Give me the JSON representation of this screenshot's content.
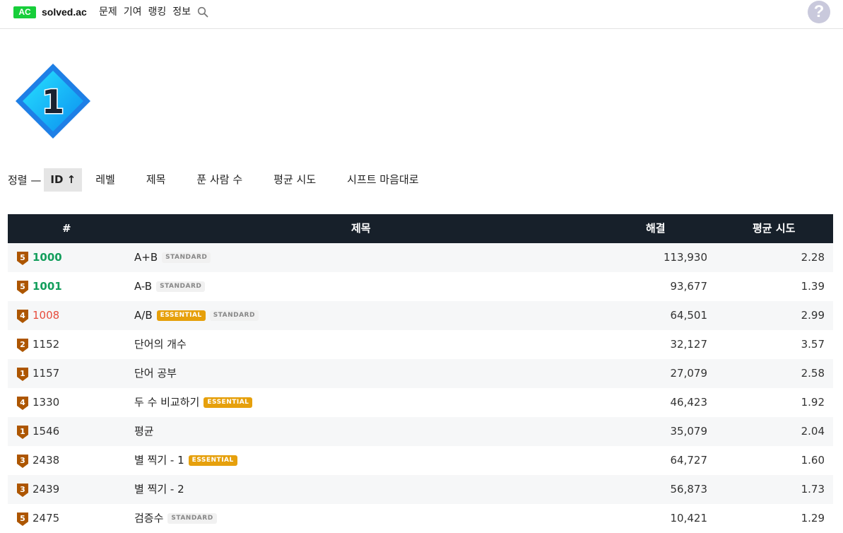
{
  "header": {
    "logo_badge": "AC",
    "logo_text": "solved.ac",
    "nav": [
      "문제",
      "기여",
      "랭킹",
      "정보"
    ],
    "search_icon": "search-icon",
    "help_icon_text": "?"
  },
  "colors": {
    "accent_green": "#17ce3a",
    "header_bg": "#17202a",
    "solved": "#139e5c",
    "wrong": "#e74c3c",
    "essential_tag": "#e6a00c",
    "bronze": "#ad5600"
  },
  "tier_badge": {
    "label": "1",
    "icon": "diamond-tier-badge"
  },
  "sort": {
    "label": "정렬 —",
    "options": [
      "ID ↑",
      "레벨",
      "제목",
      "푼 사람 수",
      "평균 시도",
      "시프트 마음대로"
    ]
  },
  "table": {
    "headers": {
      "id": "#",
      "title": "제목",
      "solved": "해결",
      "avg": "평균 시도"
    },
    "rows": [
      {
        "tier": "5",
        "id": "1000",
        "status": "solved",
        "title": "A+B",
        "tags": [
          "STANDARD"
        ],
        "solved": "113,930",
        "avg": "2.28"
      },
      {
        "tier": "5",
        "id": "1001",
        "status": "solved",
        "title": "A-B",
        "tags": [
          "STANDARD"
        ],
        "solved": "93,677",
        "avg": "1.39"
      },
      {
        "tier": "4",
        "id": "1008",
        "status": "wrong",
        "title": "A/B",
        "tags": [
          "ESSENTIAL",
          "STANDARD"
        ],
        "solved": "64,501",
        "avg": "2.99"
      },
      {
        "tier": "2",
        "id": "1152",
        "status": "",
        "title": "단어의 개수",
        "tags": [],
        "solved": "32,127",
        "avg": "3.57"
      },
      {
        "tier": "1",
        "id": "1157",
        "status": "",
        "title": "단어 공부",
        "tags": [],
        "solved": "27,079",
        "avg": "2.58"
      },
      {
        "tier": "4",
        "id": "1330",
        "status": "",
        "title": "두 수 비교하기",
        "tags": [
          "ESSENTIAL"
        ],
        "solved": "46,423",
        "avg": "1.92"
      },
      {
        "tier": "1",
        "id": "1546",
        "status": "",
        "title": "평균",
        "tags": [],
        "solved": "35,079",
        "avg": "2.04"
      },
      {
        "tier": "3",
        "id": "2438",
        "status": "",
        "title": "별 찍기 - 1",
        "tags": [
          "ESSENTIAL"
        ],
        "solved": "64,727",
        "avg": "1.60"
      },
      {
        "tier": "3",
        "id": "2439",
        "status": "",
        "title": "별 찍기 - 2",
        "tags": [],
        "solved": "56,873",
        "avg": "1.73"
      },
      {
        "tier": "5",
        "id": "2475",
        "status": "",
        "title": "검증수",
        "tags": [
          "STANDARD"
        ],
        "solved": "10,421",
        "avg": "1.29"
      }
    ]
  }
}
